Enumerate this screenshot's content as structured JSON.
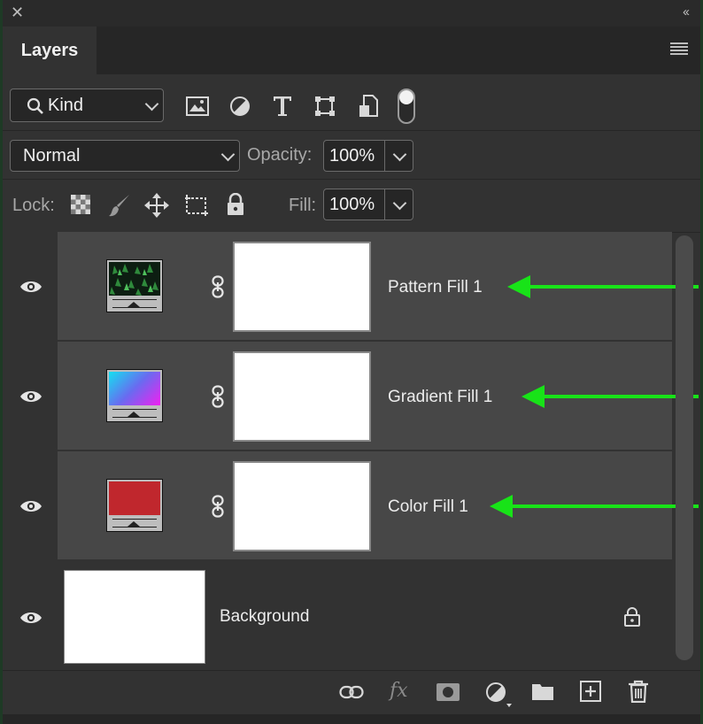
{
  "panel": {
    "close_glyph": "✕",
    "collapse_glyph": "‹‹",
    "tab_label": "Layers"
  },
  "filter": {
    "kind_label": "Kind"
  },
  "blend": {
    "mode": "Normal",
    "opacity_label": "Opacity:",
    "opacity_value": "100%"
  },
  "lock": {
    "lock_label": "Lock:",
    "fill_label": "Fill:",
    "fill_value": "100%"
  },
  "layers": [
    {
      "name": "Pattern Fill 1",
      "type": "pattern-fill",
      "visible": true
    },
    {
      "name": "Gradient Fill 1",
      "type": "gradient-fill",
      "visible": true,
      "gradient": [
        "#14e0f0",
        "#f020f0"
      ]
    },
    {
      "name": "Color Fill 1",
      "type": "color-fill",
      "visible": true,
      "color": "#c0272d"
    },
    {
      "name": "Background",
      "type": "background",
      "visible": true,
      "locked": true
    }
  ],
  "fx_label": "fx",
  "colors": {
    "annotation_arrow": "#18e318",
    "panel_bg": "#323232",
    "selected_layer_bg": "#474747"
  }
}
